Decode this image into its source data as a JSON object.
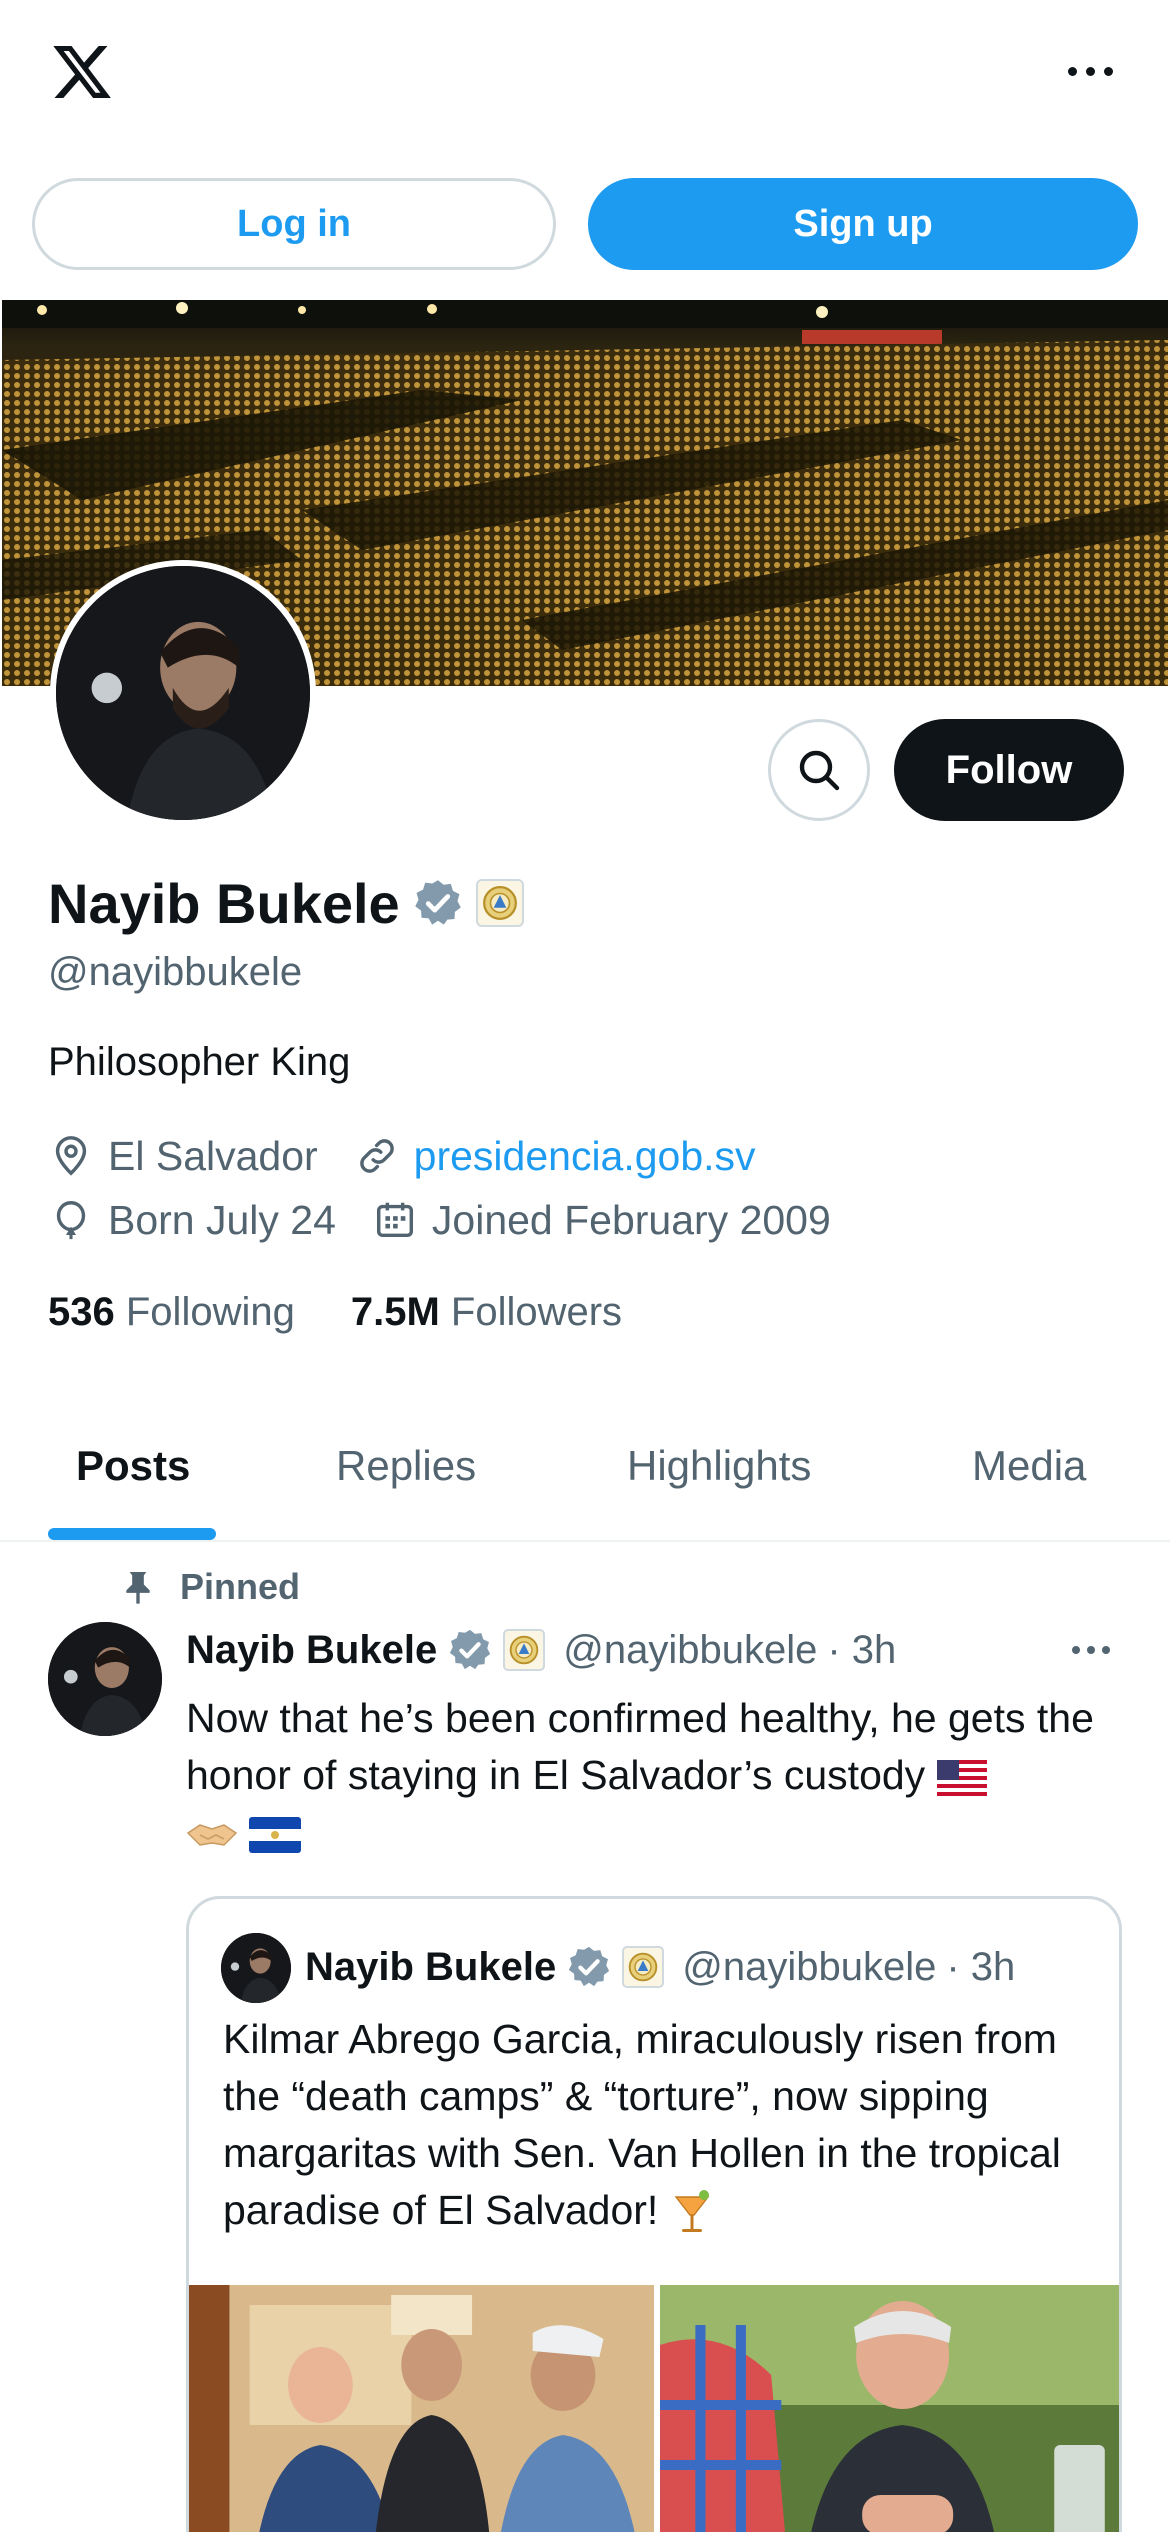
{
  "header": {
    "logo_icon": "x-logo-icon",
    "more_icon": "more-horizontal-icon"
  },
  "auth": {
    "login_label": "Log in",
    "signup_label": "Sign up"
  },
  "profile": {
    "name": "Nayib Bukele",
    "handle": "@nayibbukele",
    "bio": "Philosopher King",
    "location": "El Salvador",
    "website": "presidencia.gob.sv",
    "birthday": "Born July 24",
    "joined": "Joined February 2009",
    "following_count": "536",
    "following_label": "Following",
    "followers_count": "7.5M",
    "followers_label": "Followers",
    "follow_label": "Follow"
  },
  "tabs": [
    {
      "label": "Posts",
      "active": true
    },
    {
      "label": "Replies",
      "active": false
    },
    {
      "label": "Highlights",
      "active": false
    },
    {
      "label": "Media",
      "active": false
    }
  ],
  "pinned_tweet": {
    "pinned_label": "Pinned",
    "author": "Nayib Bukele",
    "handle": "@nayibbukele",
    "time": "· 3h",
    "text": "Now that he’s been confirmed healthy, he gets the honor of staying in El Salvador’s custody",
    "quoted": {
      "author": "Nayib Bukele",
      "handle": "@nayibbukele",
      "time": "· 3h",
      "text": "Kilmar Abrego Garcia, miraculously risen from the “death camps” & “torture”, now sipping margaritas with Sen. Van Hollen in the tropical paradise of El Salvador!"
    }
  },
  "colors": {
    "accent": "#1d9bf0",
    "text": "#0f1419",
    "secondary": "#536471",
    "border": "#cfd9de"
  }
}
